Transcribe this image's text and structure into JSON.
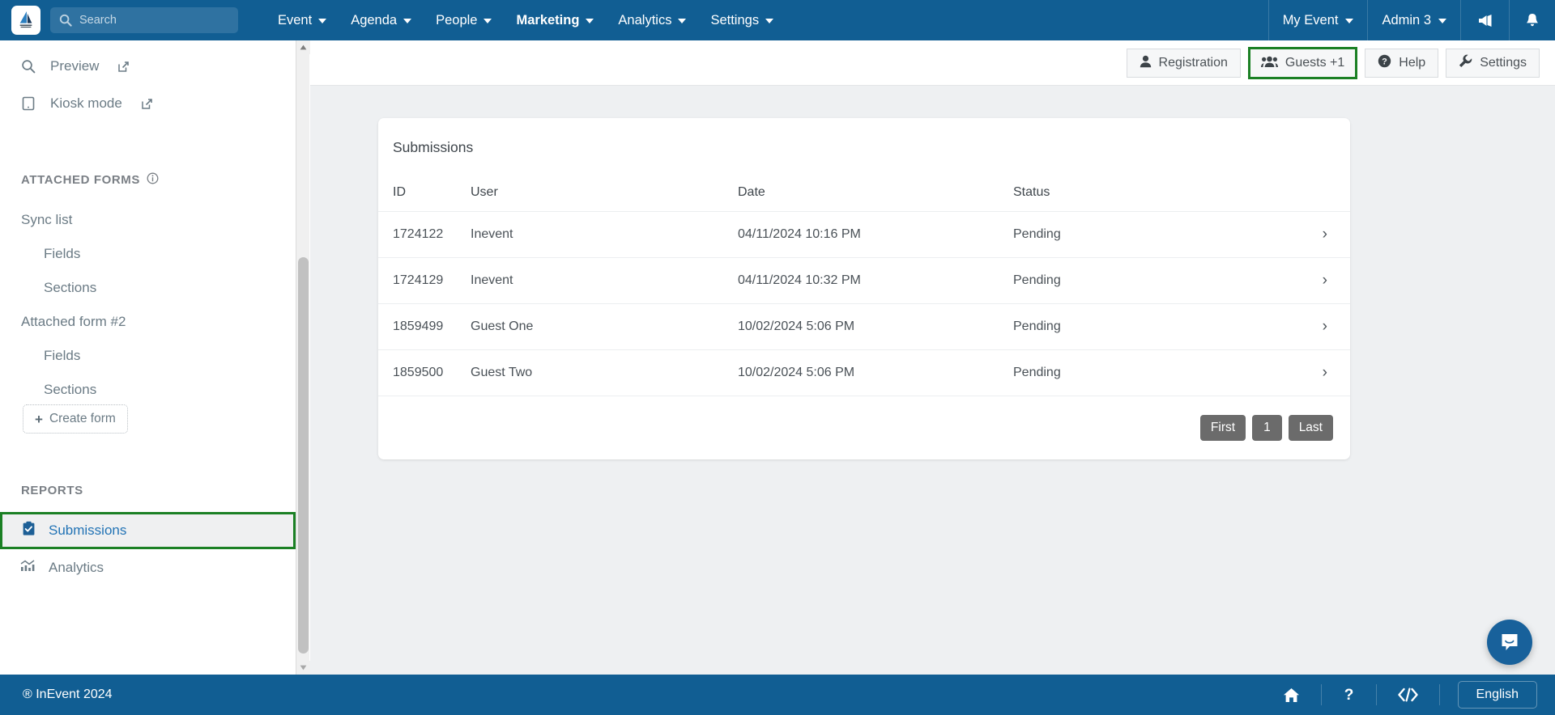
{
  "topbar": {
    "logo_icon": "inevent-logo-icon",
    "search": {
      "placeholder": "Search",
      "value": "",
      "icon": "search-icon"
    },
    "nav": [
      {
        "label": "Event",
        "bold": false
      },
      {
        "label": "Agenda",
        "bold": false
      },
      {
        "label": "People",
        "bold": false
      },
      {
        "label": "Marketing",
        "bold": true
      },
      {
        "label": "Analytics",
        "bold": false
      },
      {
        "label": "Settings",
        "bold": false
      }
    ],
    "right": [
      {
        "label": "My Event",
        "caret": true
      },
      {
        "label": "Admin 3",
        "caret": true
      }
    ],
    "icons": [
      {
        "name": "megaphone-icon"
      },
      {
        "name": "bell-icon"
      }
    ]
  },
  "sidebar": {
    "top_items": [
      {
        "label": "Preview",
        "icon": "search-icon",
        "external": true
      },
      {
        "label": "Kiosk mode",
        "icon": "tablet-icon",
        "external": true
      }
    ],
    "attached_forms_header": "ATTACHED FORMS",
    "attached_forms_info_icon": "info-icon",
    "forms": [
      {
        "label": "Sync list",
        "indent": false
      },
      {
        "label": "Fields",
        "indent": true
      },
      {
        "label": "Sections",
        "indent": true
      },
      {
        "label": "Attached form #2",
        "indent": false
      },
      {
        "label": "Fields",
        "indent": true
      },
      {
        "label": "Sections",
        "indent": true
      }
    ],
    "create_form_label": "Create form",
    "reports_header": "REPORTS",
    "reports": [
      {
        "label": "Submissions",
        "icon": "clipboard-check-icon",
        "active": true
      },
      {
        "label": "Analytics",
        "icon": "chart-icon",
        "active": false
      }
    ]
  },
  "page_header": {
    "buttons": [
      {
        "label": "Registration",
        "icon": "user-icon",
        "highlighted": false
      },
      {
        "label": "Guests +1",
        "icon": "users-icon",
        "highlighted": true
      },
      {
        "label": "Help",
        "icon": "question-circle-icon",
        "highlighted": false
      },
      {
        "label": "Settings",
        "icon": "wrench-icon",
        "highlighted": false
      }
    ]
  },
  "main": {
    "card_title": "Submissions",
    "table": {
      "columns": [
        "ID",
        "User",
        "Date",
        "Status"
      ],
      "rows": [
        {
          "id": "1724122",
          "user": "Inevent",
          "date": "04/11/2024 10:16 PM",
          "status": "Pending"
        },
        {
          "id": "1724129",
          "user": "Inevent",
          "date": "04/11/2024 10:32 PM",
          "status": "Pending"
        },
        {
          "id": "1859499",
          "user": "Guest One",
          "date": "10/02/2024 5:06 PM",
          "status": "Pending"
        },
        {
          "id": "1859500",
          "user": "Guest Two",
          "date": "10/02/2024 5:06 PM",
          "status": "Pending"
        }
      ]
    },
    "pagination": {
      "first": "First",
      "current": "1",
      "last": "Last"
    }
  },
  "chat": {
    "icon": "chat-bubble-icon"
  },
  "footer": {
    "copyright": "® InEvent 2024",
    "icons": [
      {
        "name": "home-icon"
      },
      {
        "name": "question-mark-icon"
      },
      {
        "name": "code-icon"
      }
    ],
    "language": "English"
  },
  "colors": {
    "brand_blue": "#115E93",
    "highlight_green": "#1b8024",
    "active_link_blue": "#2273b5",
    "pager_gray": "#6b6b6b",
    "content_bg": "#eef0f2"
  }
}
